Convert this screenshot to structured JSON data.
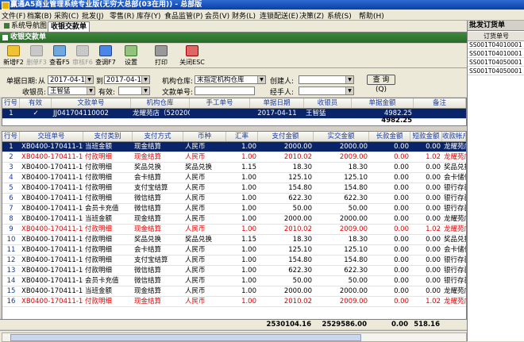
{
  "app": {
    "title": "赢通A5商业管理系统专业版(无穷大总部(03在用)) - 总部版"
  },
  "menu": [
    "文件(F)",
    "档案(B)",
    "采购(C)",
    "批发(J)",
    "零售(R)",
    "库存(Y)",
    "食品监管(P)",
    "会员(V)",
    "财务(L)",
    "连锁配送(E)",
    "决策(Z)",
    "系统(S)",
    "帮助(H)"
  ],
  "tabs": [
    {
      "label": "系统导航图",
      "active": false
    },
    {
      "label": "收银交款单",
      "active": true
    }
  ],
  "right_panel": {
    "title": "批发订货单",
    "column": "订货单号",
    "rows": [
      "SS001T04010001",
      "SS001T04010001",
      "SS001T04050001",
      "SS001T04050001"
    ]
  },
  "window_title": "收银交款单",
  "toolbar": [
    {
      "label": "新增F2",
      "icon": "new-doc-icon",
      "enabled": true
    },
    {
      "label": "删单F3",
      "icon": "delete-icon",
      "enabled": false
    },
    {
      "label": "查看F5",
      "icon": "view-icon",
      "enabled": true
    },
    {
      "label": "审核F6",
      "icon": "audit-icon",
      "enabled": false
    },
    {
      "label": "查调F7",
      "icon": "query-icon",
      "enabled": true
    },
    {
      "label": "设置",
      "icon": "settings-icon",
      "enabled": true
    },
    {
      "label": "打印",
      "icon": "print-icon",
      "enabled": true
    },
    {
      "label": "关闭ESC",
      "icon": "close-icon",
      "enabled": true
    }
  ],
  "filters": {
    "date_label": "单据日期:",
    "from_label": "从",
    "date_from": "2017-04-11",
    "to_label": "到",
    "date_to": "2017-04-11",
    "warehouse_label": "机构仓库:",
    "warehouse": "末指定机构仓库",
    "creator_label": "创建人:",
    "creator": "",
    "cashier_label": "收银员:",
    "cashier": "王智猛",
    "valid_label": "有效:",
    "valid": "",
    "docno_label": "文款单号:",
    "docno": "",
    "handler_label": "经手人:",
    "handler": "",
    "query_button": "查 询(Q)"
  },
  "master": {
    "columns": [
      "行号",
      "有效",
      "文款单号",
      "机构仓库",
      "手工单号",
      "单据日期",
      "收银员",
      "单据金额",
      "备注"
    ],
    "rows": [
      {
        "no": "1",
        "valid": "✓",
        "docno": "JJ041704110002",
        "warehouse": "龙耀苑店（5202003)",
        "manual": "",
        "date": "2017-04-11",
        "cashier": "王智猛",
        "amount": "4982.25",
        "note": ""
      }
    ],
    "total": "4982.25"
  },
  "detail": {
    "columns": [
      "行号",
      "交班单号",
      "支付类别",
      "支付方式",
      "币种",
      "汇率",
      "支付金额",
      "实交金额",
      "长款金额",
      "短款金额",
      "收款帐户"
    ],
    "rows": [
      {
        "no": "1",
        "shift": "XB0400-170411-1611",
        "cat": "当班金额",
        "method": "现金结算",
        "cur": "人民币",
        "rate": "1.00",
        "pay": "2000.00",
        "real": "2000.00",
        "over": "0.00",
        "short": "0.00",
        "acct": "龙耀苑店现金",
        "state": "sel"
      },
      {
        "no": "2",
        "shift": "XB0400-170411-1611",
        "cat": "付款明细",
        "method": "现金结算",
        "cur": "人民币",
        "rate": "1.00",
        "pay": "2010.02",
        "real": "2009.00",
        "over": "0.00",
        "short": "1.02",
        "acct": "龙耀苑店现金",
        "state": "red"
      },
      {
        "no": "3",
        "shift": "XB0400-170411-1611",
        "cat": "付款明细",
        "method": "奖品兑换",
        "cur": "奖品兑换",
        "rate": "1.15",
        "pay": "18.30",
        "real": "18.30",
        "over": "0.00",
        "short": "0.00",
        "acct": "奖品兑换",
        "state": ""
      },
      {
        "no": "4",
        "shift": "XB0400-170411-1611",
        "cat": "付款明细",
        "method": "会卡结算",
        "cur": "人民币",
        "rate": "1.00",
        "pay": "125.10",
        "real": "125.10",
        "over": "0.00",
        "short": "0.00",
        "acct": "会卡储值",
        "state": ""
      },
      {
        "no": "5",
        "shift": "XB0400-170411-1611",
        "cat": "付款明细",
        "method": "支付宝结算",
        "cur": "人民币",
        "rate": "1.00",
        "pay": "154.80",
        "real": "154.80",
        "over": "0.00",
        "short": "0.00",
        "acct": "银行存款（帐户9469）",
        "state": ""
      },
      {
        "no": "6",
        "shift": "XB0400-170411-1611",
        "cat": "付款明细",
        "method": "微信结算",
        "cur": "人民币",
        "rate": "1.00",
        "pay": "622.30",
        "real": "622.30",
        "over": "0.00",
        "short": "0.00",
        "acct": "银行存款（帐户9469）",
        "state": ""
      },
      {
        "no": "7",
        "shift": "XB0400-170411-1611",
        "cat": "会员卡充值",
        "method": "微信结算",
        "cur": "人民币",
        "rate": "1.00",
        "pay": "50.00",
        "real": "50.00",
        "over": "0.00",
        "short": "0.00",
        "acct": "银行存款（帐户9469）",
        "state": ""
      },
      {
        "no": "8",
        "shift": "XB0400-170411-1611",
        "cat": "当班金额",
        "method": "现金结算",
        "cur": "人民币",
        "rate": "1.00",
        "pay": "2000.00",
        "real": "2000.00",
        "over": "0.00",
        "short": "0.00",
        "acct": "龙耀苑店现金",
        "state": ""
      },
      {
        "no": "9",
        "shift": "XB0400-170411-1611",
        "cat": "付款明细",
        "method": "现金结算",
        "cur": "人民币",
        "rate": "1.00",
        "pay": "2010.02",
        "real": "2009.00",
        "over": "0.00",
        "short": "1.02",
        "acct": "龙耀苑店现金",
        "state": "red"
      },
      {
        "no": "10",
        "shift": "XB0400-170411-1611",
        "cat": "付款明细",
        "method": "奖品兑换",
        "cur": "奖品兑换",
        "rate": "1.15",
        "pay": "18.30",
        "real": "18.30",
        "over": "0.00",
        "short": "0.00",
        "acct": "奖品兑换",
        "state": ""
      },
      {
        "no": "11",
        "shift": "XB0400-170411-1611",
        "cat": "付款明细",
        "method": "会卡结算",
        "cur": "人民币",
        "rate": "1.00",
        "pay": "125.10",
        "real": "125.10",
        "over": "0.00",
        "short": "0.00",
        "acct": "会卡储值",
        "state": ""
      },
      {
        "no": "12",
        "shift": "XB0400-170411-1611",
        "cat": "付款明细",
        "method": "支付宝结算",
        "cur": "人民币",
        "rate": "1.00",
        "pay": "154.80",
        "real": "154.80",
        "over": "0.00",
        "short": "0.00",
        "acct": "银行存款（帐户9469）",
        "state": ""
      },
      {
        "no": "13",
        "shift": "XB0400-170411-1611",
        "cat": "付款明细",
        "method": "微信结算",
        "cur": "人民币",
        "rate": "1.00",
        "pay": "622.30",
        "real": "622.30",
        "over": "0.00",
        "short": "0.00",
        "acct": "银行存款（帐户9469）",
        "state": ""
      },
      {
        "no": "14",
        "shift": "XB0400-170411-1611",
        "cat": "会员卡充值",
        "method": "微信结算",
        "cur": "人民币",
        "rate": "1.00",
        "pay": "50.00",
        "real": "50.00",
        "over": "0.00",
        "short": "0.00",
        "acct": "银行存款（帐户9469）",
        "state": ""
      },
      {
        "no": "15",
        "shift": "XB0400-170411-1611",
        "cat": "当班金额",
        "method": "现金结算",
        "cur": "人民币",
        "rate": "1.00",
        "pay": "2000.00",
        "real": "2000.00",
        "over": "0.00",
        "short": "0.00",
        "acct": "龙耀苑店现金",
        "state": ""
      },
      {
        "no": "16",
        "shift": "XB0400-170411-1611",
        "cat": "付款明细",
        "method": "现金结算",
        "cur": "人民币",
        "rate": "1.00",
        "pay": "2010.02",
        "real": "2009.00",
        "over": "0.00",
        "short": "1.02",
        "acct": "龙耀苑店现金",
        "state": "red"
      }
    ],
    "totals": {
      "pay": "2530104.16",
      "real": "2529586.00",
      "over": "0.00",
      "short": "518.16"
    }
  },
  "colors": {
    "selected_row": "#0a246a",
    "alert_text": "#e00000",
    "header_text": "#1a3a9a",
    "window_header": "#2a6a2a"
  }
}
